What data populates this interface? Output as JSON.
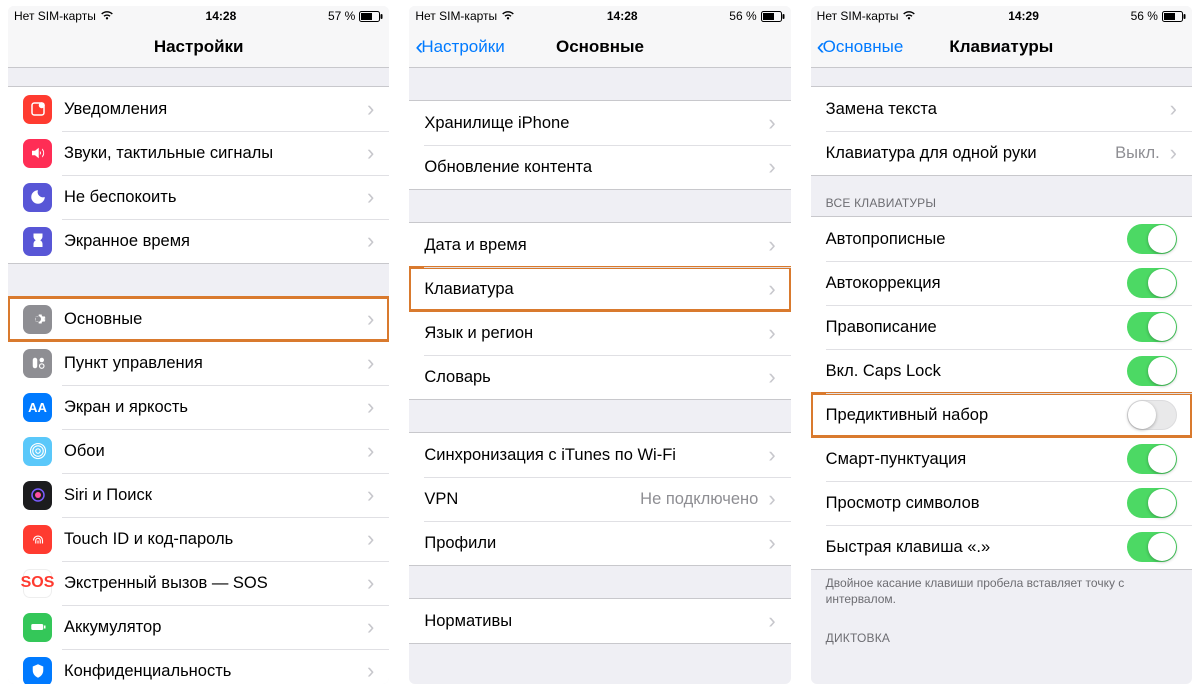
{
  "screens": [
    {
      "status": {
        "carrier": "Нет SIM-карты",
        "time": "14:28",
        "battery": "57 %"
      },
      "nav": {
        "back": null,
        "title": "Настройки"
      },
      "groups": [
        {
          "rows": [
            {
              "icon": "notifications-icon",
              "color": "ic-red",
              "label": "Уведомления"
            },
            {
              "icon": "sounds-icon",
              "color": "ic-pink",
              "label": "Звуки, тактильные сигналы"
            },
            {
              "icon": "dnd-icon",
              "color": "ic-indigo",
              "label": "Не беспокоить"
            },
            {
              "icon": "screentime-icon",
              "color": "ic-indigo",
              "label": "Экранное время"
            }
          ]
        },
        {
          "rows": [
            {
              "icon": "general-icon",
              "color": "ic-gray",
              "label": "Основные",
              "highlight": true
            },
            {
              "icon": "control-center-icon",
              "color": "ic-gray",
              "label": "Пункт управления"
            },
            {
              "icon": "display-icon",
              "color": "ic-blue",
              "label": "Экран и яркость"
            },
            {
              "icon": "wallpaper-icon",
              "color": "ic-cyan",
              "label": "Обои"
            },
            {
              "icon": "siri-icon",
              "color": "ic-black",
              "label": "Siri и Поиск"
            },
            {
              "icon": "touchid-icon",
              "color": "ic-red",
              "label": "Touch ID и код-пароль"
            },
            {
              "icon": "sos-icon",
              "color": "ic-sos",
              "label": "Экстренный вызов — SOS"
            },
            {
              "icon": "battery-icon",
              "color": "ic-green",
              "label": "Аккумулятор"
            },
            {
              "icon": "privacy-icon",
              "color": "ic-blue",
              "label": "Конфиденциальность"
            }
          ]
        }
      ]
    },
    {
      "status": {
        "carrier": "Нет SIM-карты",
        "time": "14:28",
        "battery": "56 %"
      },
      "nav": {
        "back": "Настройки",
        "title": "Основные"
      },
      "groups": [
        {
          "spacer": true
        },
        {
          "rows": [
            {
              "label": "Хранилище iPhone"
            },
            {
              "label": "Обновление контента"
            }
          ]
        },
        {
          "rows": [
            {
              "label": "Дата и время"
            },
            {
              "label": "Клавиатура",
              "highlight": true
            },
            {
              "label": "Язык и регион"
            },
            {
              "label": "Словарь"
            }
          ]
        },
        {
          "rows": [
            {
              "label": "Синхронизация с iTunes по Wi-Fi"
            },
            {
              "label": "VPN",
              "detail": "Не подключено"
            },
            {
              "label": "Профили"
            }
          ]
        },
        {
          "rows": [
            {
              "label": "Нормативы"
            }
          ]
        }
      ]
    },
    {
      "status": {
        "carrier": "Нет SIM-карты",
        "time": "14:29",
        "battery": "56 %"
      },
      "nav": {
        "back": "Основные",
        "title": "Клавиатуры"
      },
      "groups": [
        {
          "rows": [
            {
              "label": "Замена текста"
            },
            {
              "label": "Клавиатура для одной руки",
              "detail": "Выкл."
            }
          ]
        },
        {
          "header": "ВСЕ КЛАВИАТУРЫ",
          "rows": [
            {
              "label": "Автопрописные",
              "toggle": true
            },
            {
              "label": "Автокоррекция",
              "toggle": true
            },
            {
              "label": "Правописание",
              "toggle": true
            },
            {
              "label": "Вкл. Caps Lock",
              "toggle": true
            },
            {
              "label": "Предиктивный набор",
              "toggle": false,
              "highlight": true
            },
            {
              "label": "Смарт-пунктуация",
              "toggle": true
            },
            {
              "label": "Просмотр символов",
              "toggle": true
            },
            {
              "label": "Быстрая клавиша «.»",
              "toggle": true
            }
          ],
          "footer": "Двойное касание клавиши пробела вставляет точку с интервалом."
        },
        {
          "header": "ДИКТОВКА",
          "rows": []
        }
      ]
    }
  ]
}
